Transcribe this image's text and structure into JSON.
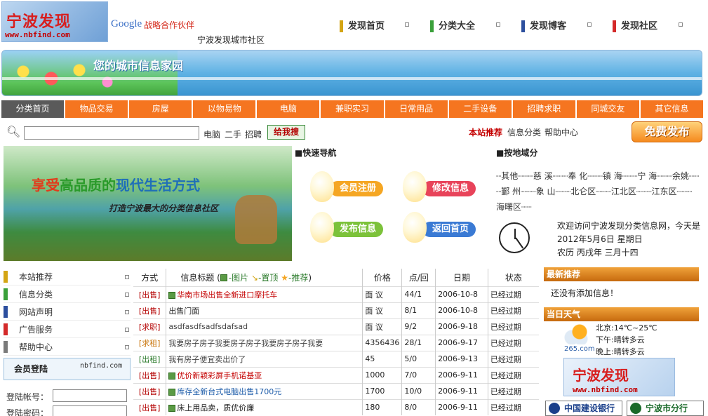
{
  "header": {
    "logo_cn": "宁波发现",
    "logo_url": "www.nbfind.com",
    "google": "Google",
    "partner": "战略合作伙伴",
    "community": "宁波发现城市社区",
    "nav": [
      {
        "label": "发现首页",
        "color": "#d4a514"
      },
      {
        "label": "分类大全",
        "color": "#3aa03a"
      },
      {
        "label": "发现博客",
        "color": "#2c4f9e"
      },
      {
        "label": "发现社区",
        "color": "#d42a2a"
      }
    ]
  },
  "banner": {
    "title": "您的城市信息家园"
  },
  "categories": [
    "分类首页",
    "物品交易",
    "房屋",
    "以物易物",
    "电脑",
    "兼职实习",
    "日常用品",
    "二手设备",
    "招聘求职",
    "同城交友",
    "其它信息"
  ],
  "search": {
    "value": "",
    "hot": [
      "电脑",
      "二手",
      "招聘"
    ],
    "button": "给我搜",
    "links": [
      "本站推荐",
      "信息分类",
      "帮助中心"
    ],
    "publish": "免费发布"
  },
  "promo": {
    "slogan_part1": "享受",
    "slogan_part2": "高品质的",
    "slogan_part3": "现代生活方式",
    "sub": "打造宁波最大的分类信息社区"
  },
  "quicknav": {
    "title": "■快速导航",
    "buttons": [
      {
        "label": "会员注册",
        "color": "#f5a623"
      },
      {
        "label": "修改信息",
        "color": "#e8435a"
      },
      {
        "label": "发布信息",
        "color": "#7cc23a"
      },
      {
        "label": "返回首页",
        "color": "#3a7ad4"
      }
    ]
  },
  "area": {
    "title": "■按地域分",
    "text": "┈其他┈┈┈慈 溪┈┈┈奉 化┈┈┈镇 海┈┈┈宁 海┈┈┈余姚┈┈┈鄞 州┈┈┈象 山┈┈┈北仑区┈┈┈江北区┈┈┈江东区┈┈┈海曙区┈┈"
  },
  "welcome": {
    "line1": "欢迎访问宁波发现分类信息网，今天是",
    "line2": "2012年5月6日  星期日",
    "line3": "农历 丙戌年  三月十四"
  },
  "sidebar": {
    "items": [
      {
        "label": "本站推荐",
        "color": "#d4a514"
      },
      {
        "label": "信息分类",
        "color": "#3aa03a"
      },
      {
        "label": "网站声明",
        "color": "#2c4f9e"
      },
      {
        "label": "广告服务",
        "color": "#d42a2a"
      },
      {
        "label": "帮助中心",
        "color": "#7a7a7a"
      }
    ],
    "login_title": "会员登陆",
    "login_domain": "nbfind.com",
    "account_label": "登陆帐号：",
    "password_label": "登陆密码："
  },
  "table": {
    "headers": {
      "type": "方式",
      "title": "信息标题",
      "legend_pic": "-图片",
      "legend_top": "-置顶",
      "legend_rec": "-推荐",
      "price": "价格",
      "clicks": "点/回",
      "date": "日期",
      "status": "状态"
    },
    "rows": [
      {
        "type": "[出售]",
        "type_color": "#b30000",
        "title": "华南市场出售全新进口摩托车",
        "title_color": "#c40000",
        "img": true,
        "price": "面 议",
        "clicks": "44/1",
        "date": "2006-10-8",
        "status": "已经过期"
      },
      {
        "type": "[出售]",
        "type_color": "#b30000",
        "title": "出售门面",
        "title_color": "#222",
        "img": false,
        "price": "面 议",
        "clicks": "8/1",
        "date": "2006-10-8",
        "status": "已经过期"
      },
      {
        "type": "[求职]",
        "type_color": "#b30000",
        "title": "asdfasdfsadfsdafsad",
        "title_color": "#444",
        "img": false,
        "price": "面 议",
        "clicks": "9/2",
        "date": "2006-9-18",
        "status": "已经过期"
      },
      {
        "type": "[求租]",
        "type_color": "#c8740a",
        "title": "我要房子房子我要房子房子我要房子房子我要",
        "title_color": "#444",
        "img": false,
        "price": "4356436",
        "clicks": "28/1",
        "date": "2006-9-17",
        "status": "已经过期"
      },
      {
        "type": "[出租]",
        "type_color": "#2a7a2a",
        "title": "我有房子便宜卖出价了",
        "title_color": "#444",
        "img": false,
        "price": "45",
        "clicks": "5/0",
        "date": "2006-9-13",
        "status": "已经过期"
      },
      {
        "type": "[出售]",
        "type_color": "#b30000",
        "title": "优价新颖彩屏手机诺基亚",
        "title_color": "#c40000",
        "img": true,
        "price": "1000",
        "clicks": "7/0",
        "date": "2006-9-11",
        "status": "已经过期"
      },
      {
        "type": "[出售]",
        "type_color": "#b30000",
        "title": "库存全新台式电脑出售1700元",
        "title_color": "#1a5aa8",
        "img": true,
        "price": "1700",
        "clicks": "10/0",
        "date": "2006-9-11",
        "status": "已经过期"
      },
      {
        "type": "[出售]",
        "type_color": "#b30000",
        "title": "床上用品卖，质优价廉",
        "title_color": "#222",
        "img": true,
        "price": "180",
        "clicks": "8/0",
        "date": "2006-9-11",
        "status": "已经过期"
      }
    ]
  },
  "right": {
    "latest_title": "最新推荐",
    "latest_empty": "还没有添加信息！",
    "weather_title": "当日天气",
    "weather_site": "265.com",
    "weather_lines": [
      "北京:14℃~25℃",
      "下午:晴转多云",
      "晚上:晴转多云"
    ],
    "ad_logo_cn": "宁波发现",
    "ad_logo_url": "www.nbfind.com",
    "bank1": "中国建设银行",
    "bank2": "宁波市分行"
  }
}
